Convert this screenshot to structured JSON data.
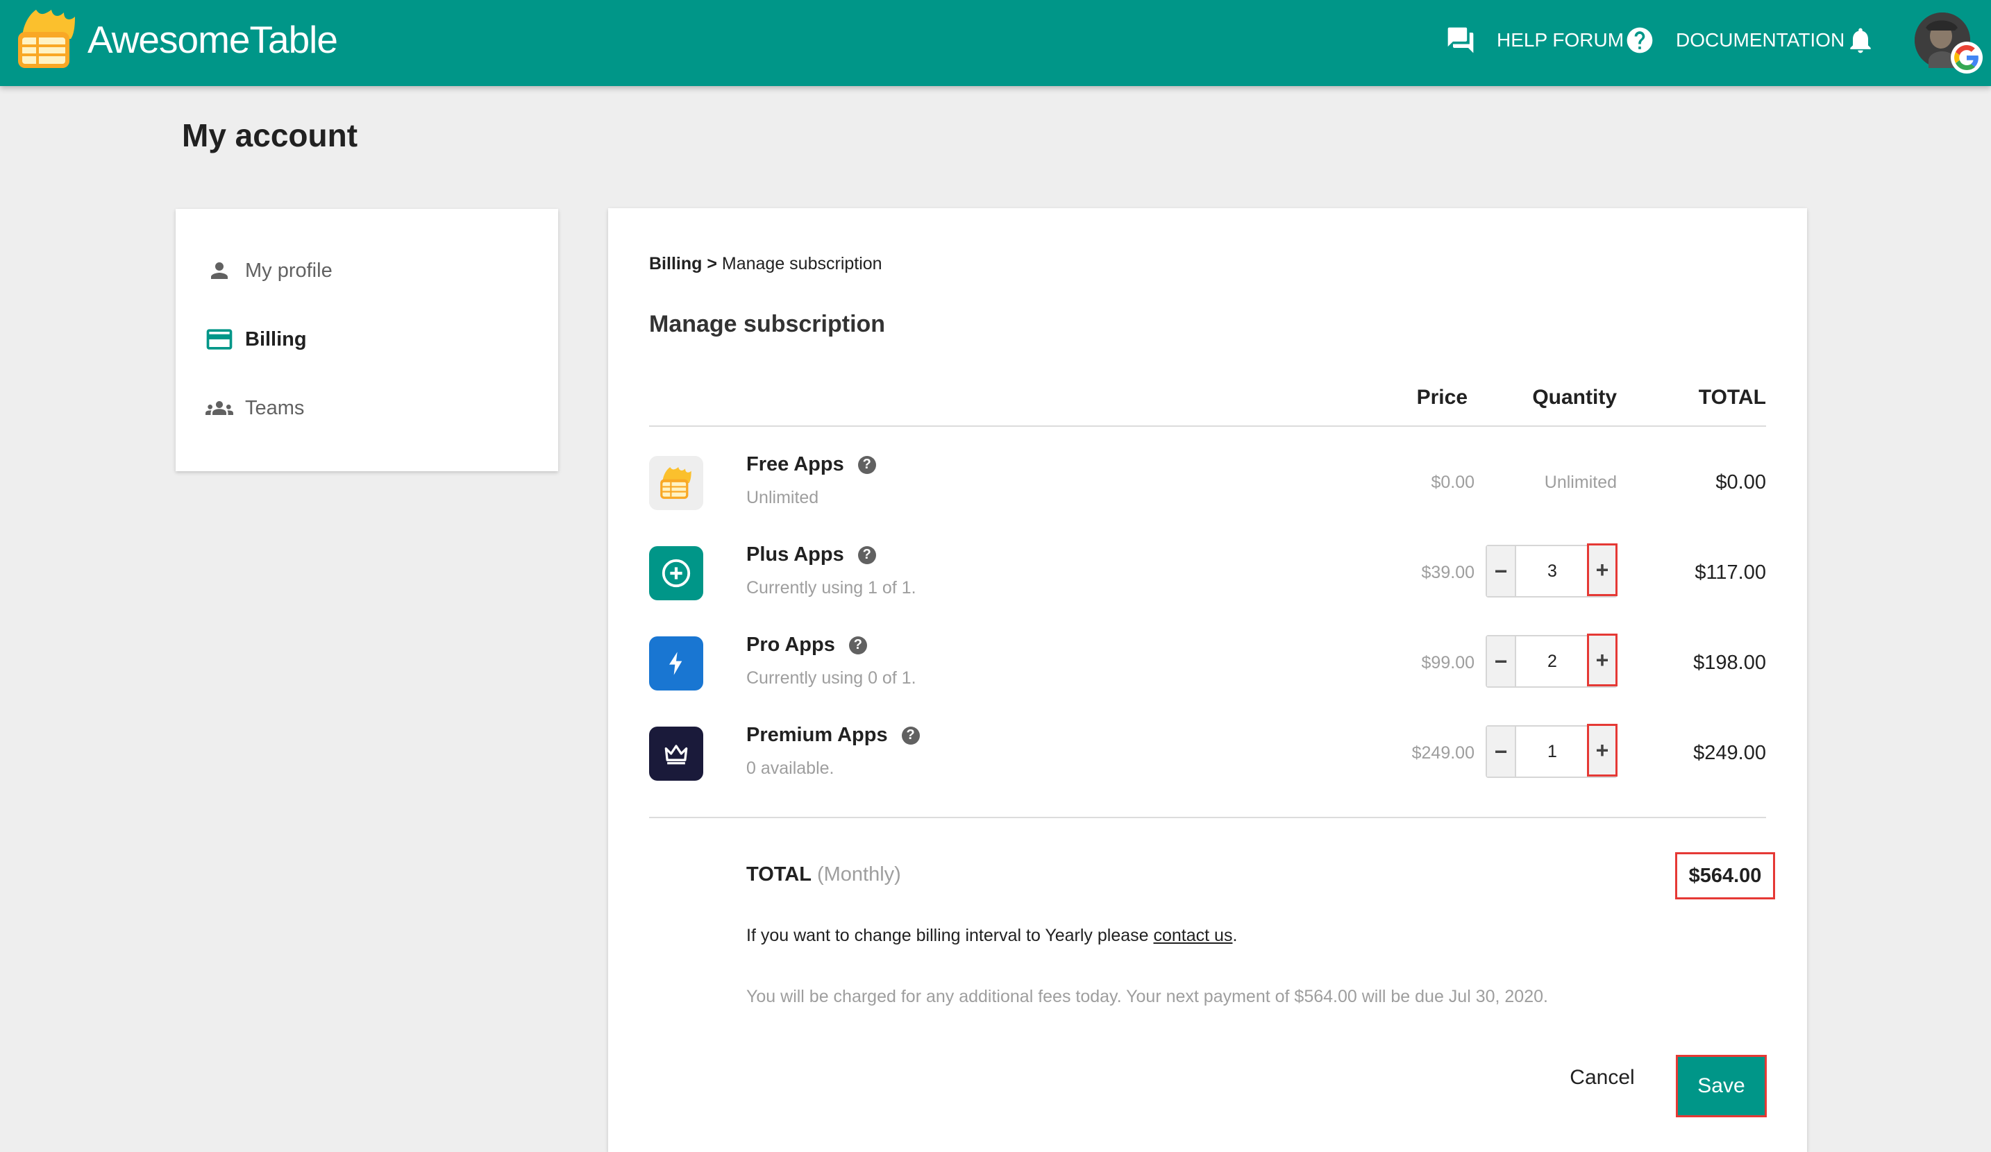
{
  "header": {
    "brand": "AwesomeTable",
    "help_forum": "HELP FORUM",
    "documentation": "DOCUMENTATION",
    "brand_color": "#009688"
  },
  "page": {
    "title": "My account"
  },
  "sidebar": {
    "items": [
      {
        "label": "My profile",
        "icon": "person-icon",
        "active": false
      },
      {
        "label": "Billing",
        "icon": "credit-card-icon",
        "active": true
      },
      {
        "label": "Teams",
        "icon": "people-icon",
        "active": false
      }
    ]
  },
  "main": {
    "breadcrumb_root": "Billing",
    "breadcrumb_separator": " > ",
    "breadcrumb_current": "Manage subscription",
    "title": "Manage subscription",
    "columns": {
      "price": "Price",
      "quantity": "Quantity",
      "total": "TOTAL"
    },
    "plans": [
      {
        "name": "Free Apps",
        "subtitle": "Unlimited",
        "price": "$0.00",
        "quantity": "Unlimited",
        "total": "$0.00",
        "icon": "awesometable-logo-icon",
        "icon_bg": "#eeeeee"
      },
      {
        "name": "Plus Apps",
        "subtitle": "Currently using 1 of 1.",
        "price": "$39.00",
        "quantity": "3",
        "total": "$117.00",
        "icon": "plus-circle-icon",
        "icon_bg": "#009688"
      },
      {
        "name": "Pro Apps",
        "subtitle": "Currently using 0 of 1.",
        "price": "$99.00",
        "quantity": "2",
        "total": "$198.00",
        "icon": "lightning-icon",
        "icon_bg": "#1976d2"
      },
      {
        "name": "Premium Apps",
        "subtitle": "0 available.",
        "price": "$249.00",
        "quantity": "1",
        "total": "$249.00",
        "icon": "crown-icon",
        "icon_bg": "#1a1a3a"
      }
    ],
    "stepper": {
      "minus": "−",
      "plus": "+"
    },
    "help_glyph": "?",
    "total_label": "TOTAL",
    "total_period": "(Monthly)",
    "grand_total": "$564.00",
    "interval_note_prefix": "If you want to change billing interval to Yearly please ",
    "interval_note_link": "contact us",
    "interval_note_suffix": ".",
    "charge_note": "You will be charged for any additional fees today. Your next payment of $564.00 will be due Jul 30, 2020.",
    "cancel_label": "Cancel",
    "save_label": "Save",
    "highlight_color": "#e53935"
  }
}
